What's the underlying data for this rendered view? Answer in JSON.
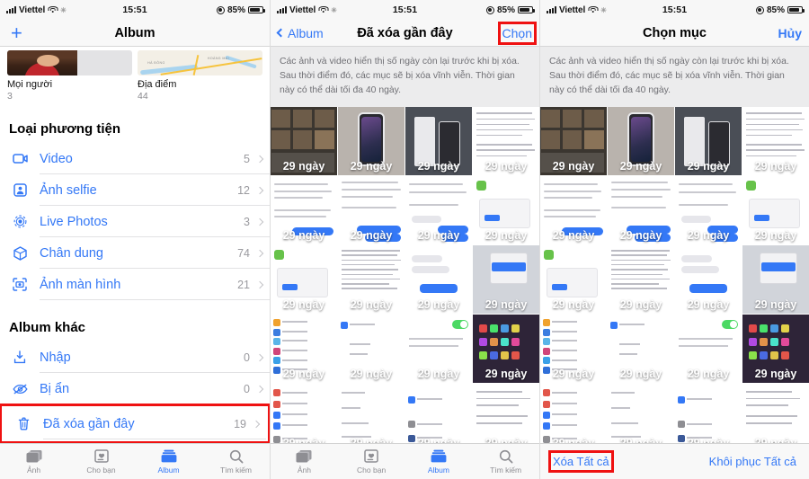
{
  "statusbar": {
    "carrier": "Viettel",
    "time": "15:51",
    "battery_pct": "85%",
    "wifi_icon": "wifi-icon",
    "signal_icon": "cellular-signal-icon",
    "sync_icon": "sync-icon",
    "location_icon": "location-services-icon",
    "battery_icon": "battery-icon"
  },
  "panel_left": {
    "nav": {
      "add_icon": "plus-icon",
      "title": "Album"
    },
    "top_albums": [
      {
        "title": "Mọi người",
        "count": "3",
        "thumb": "people-thumbnail"
      },
      {
        "title": "Địa điểm",
        "count": "44",
        "thumb": "map-thumbnail",
        "map_labels": [
          "HÀ ĐÔNG",
          "HOÀNG MAI"
        ]
      }
    ],
    "sections": [
      {
        "heading": "Loại phương tiện",
        "rows": [
          {
            "label": "Video",
            "count": "5",
            "icon": "video-camera-icon"
          },
          {
            "label": "Ảnh selfie",
            "count": "12",
            "icon": "selfie-portrait-icon"
          },
          {
            "label": "Live Photos",
            "count": "3",
            "icon": "live-photos-icon"
          },
          {
            "label": "Chân dung",
            "count": "74",
            "icon": "portrait-cube-icon"
          },
          {
            "label": "Ảnh màn hình",
            "count": "21",
            "icon": "screenshot-icon"
          }
        ]
      },
      {
        "heading": "Album khác",
        "rows": [
          {
            "label": "Nhập",
            "count": "0",
            "icon": "import-icon"
          },
          {
            "label": "Bị ẩn",
            "count": "0",
            "icon": "hidden-eye-icon"
          },
          {
            "label": "Đã xóa gần đây",
            "count": "19",
            "icon": "trash-icon",
            "highlighted": true
          }
        ]
      }
    ],
    "tabs": [
      {
        "label": "Ảnh",
        "icon": "photos-icon",
        "active": false
      },
      {
        "label": "Cho bạn",
        "icon": "for-you-icon",
        "active": false
      },
      {
        "label": "Album",
        "icon": "albums-icon",
        "active": true
      },
      {
        "label": "Tìm kiếm",
        "icon": "search-icon",
        "active": false
      }
    ]
  },
  "panel_middle": {
    "nav": {
      "back_label": "Album",
      "back_icon": "chevron-left-icon",
      "title": "Đã xóa gần đây",
      "action_label": "Chọn",
      "action_highlighted": true
    },
    "description": "Các ảnh và video hiển thị số ngày còn lại trước khi bị xóa. Sau thời điểm đó, các mục sẽ bị xóa vĩnh viễn. Thời gian này có thể dài tối đa 40 ngày.",
    "grid_badge": "29 ngày",
    "grid_rows": 5,
    "grid_cols": 4,
    "tabs": [
      {
        "label": "Ảnh",
        "icon": "photos-icon",
        "active": false
      },
      {
        "label": "Cho bạn",
        "icon": "for-you-icon",
        "active": false
      },
      {
        "label": "Album",
        "icon": "albums-icon",
        "active": true
      },
      {
        "label": "Tìm kiếm",
        "icon": "search-icon",
        "active": false
      }
    ]
  },
  "panel_right": {
    "nav": {
      "title": "Chọn mục",
      "action_label": "Hủy"
    },
    "description": "Các ảnh và video hiển thị số ngày còn lại trước khi bị xóa. Sau thời điểm đó, các mục sẽ bị xóa vĩnh viễn. Thời gian này có thể dài tối đa 40 ngày.",
    "grid_badge": "29 ngày",
    "grid_rows": 5,
    "grid_cols": 4,
    "actions": {
      "delete_all": "Xóa Tất cả",
      "delete_all_highlighted": true,
      "restore_all": "Khôi phục Tất cả"
    }
  },
  "colors": {
    "accent_blue": "#3478f6",
    "highlight_red": "#ef1111",
    "muted_gray": "#8e8e93",
    "banner_bg": "#ececed"
  }
}
